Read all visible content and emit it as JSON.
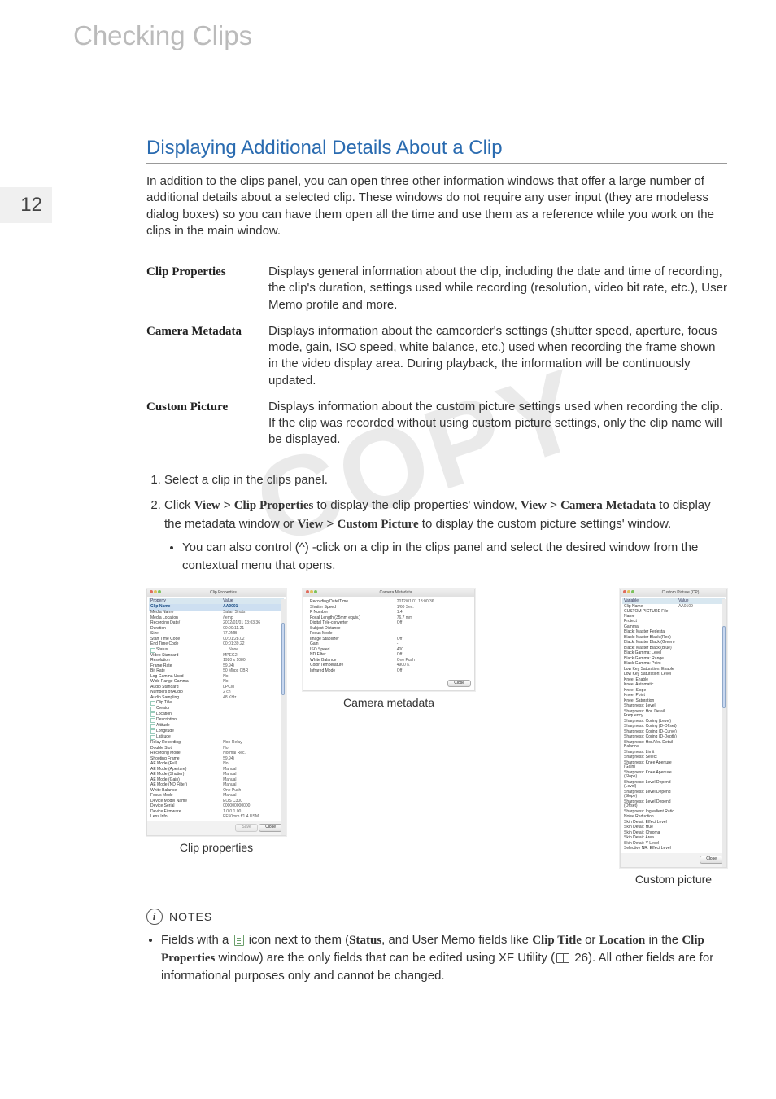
{
  "running_title": "Checking Clips",
  "page_number": "12",
  "section_heading": "Displaying Additional Details About a Clip",
  "intro": "In addition to the clips panel, you can open three other information windows that offer a large number of additional details about a selected clip. These windows do not require any user input (they are modeless dialog boxes) so you can have them open all the time and use them as a reference while you work on the clips in the main window.",
  "info_rows": [
    {
      "label": "Clip Properties",
      "desc": "Displays general information about the clip, including the date and time of recording, the clip's duration, settings used while recording (resolution, video bit rate, etc.), User Memo profile and more."
    },
    {
      "label": "Camera Metadata",
      "desc": "Displays information about the camcorder's settings (shutter speed, aperture, focus mode, gain, ISO speed, white balance, etc.) used when recording the frame shown in the video display area. During playback, the information will be continuously updated."
    },
    {
      "label": "Custom Picture",
      "desc": "Displays information about the custom picture settings used when recording the clip. If the clip was recorded without using custom picture settings, only the clip name will be displayed."
    }
  ],
  "steps": {
    "s1": "Select a clip in the clips panel.",
    "s2_a": "Click ",
    "s2_b1": "View",
    "s2_b2": "Clip Properties",
    "s2_c": " to display the clip properties' window, ",
    "s2_d1": "View",
    "s2_d2": "Camera Metadata",
    "s2_e": " to display the metadata window or ",
    "s2_f1": "View",
    "s2_f2": "Custom Picture",
    "s2_g": " to display the custom picture settings' window.",
    "s2_sub": "You can also control (^) -click on a clip in the clips panel and select the desired window from the contextual menu that opens."
  },
  "watermark": "COPY",
  "clip_props": {
    "title": "Clip Properties",
    "header_k": "Property",
    "header_v": "Value",
    "rows": [
      {
        "k": "Clip Name",
        "v": "AA0001",
        "hl": 1
      },
      {
        "k": "Media Name",
        "v": "Safari Shots"
      },
      {
        "k": "Media Location",
        "v": "/temp"
      },
      {
        "k": "Recording Date/",
        "v": "2012/01/01 13:03:36"
      },
      {
        "k": "Duration",
        "v": "00:00:11.21"
      },
      {
        "k": "Size",
        "v": "77.0MB"
      },
      {
        "k": "Start Time Code",
        "v": "00:01:28.02"
      },
      {
        "k": "End Time Code",
        "v": "00:01:39.22"
      },
      {
        "k": "Status",
        "v": "None",
        "edit": 1
      },
      {
        "k": "Video Standard",
        "v": "MPEG2"
      },
      {
        "k": "Resolution",
        "v": "1920 x 1080"
      },
      {
        "k": "Frame Rate",
        "v": "59.94i"
      },
      {
        "k": "Bit Rate",
        "v": "50 Mbps CBR"
      },
      {
        "k": "Log Gamma Used",
        "v": "No"
      },
      {
        "k": "Wide Range Gamma",
        "v": "No"
      },
      {
        "k": "Audio Standard",
        "v": "LPCM"
      },
      {
        "k": "Numbers of Audio",
        "v": "2 ch"
      },
      {
        "k": "Audio Sampling",
        "v": "48 KHz"
      },
      {
        "k": "Clip Title",
        "v": "",
        "edit": 1
      },
      {
        "k": "Creator",
        "v": "",
        "edit": 1
      },
      {
        "k": "Location",
        "v": "",
        "edit": 1
      },
      {
        "k": "Description",
        "v": "",
        "edit": 1
      },
      {
        "k": "Altitude",
        "v": "",
        "edit": 1
      },
      {
        "k": "Longitude",
        "v": "",
        "edit": 1
      },
      {
        "k": "Latitude",
        "v": "",
        "edit": 1
      },
      {
        "k": "Relay Recording",
        "v": "Non-Relay"
      },
      {
        "k": "Double Slot",
        "v": "No"
      },
      {
        "k": "Recording Mode",
        "v": "Normal Rec."
      },
      {
        "k": "Shooting Frame",
        "v": "59.94i"
      },
      {
        "k": "AE Mode (Full)",
        "v": "No"
      },
      {
        "k": "AE Mode (Aperture)",
        "v": "Manual"
      },
      {
        "k": "AE Mode (Shutter)",
        "v": "Manual"
      },
      {
        "k": "AE Mode (Gain)",
        "v": "Manual"
      },
      {
        "k": "AE Mode (ND Filter)",
        "v": "Manual"
      },
      {
        "k": "White Balance",
        "v": "One Push"
      },
      {
        "k": "Focus Mode",
        "v": "Manual"
      },
      {
        "k": "Device Model Name",
        "v": "EOS C300"
      },
      {
        "k": "Device Serial",
        "v": "000000000000"
      },
      {
        "k": "Device Firmware",
        "v": "1.0.0.1.00"
      },
      {
        "k": "Lens Info.",
        "v": "EF50mm f/1.4 USM"
      }
    ],
    "save": "Save",
    "close": "Close",
    "caption": "Clip properties"
  },
  "camera_meta": {
    "title": "Camera Metadata",
    "rows": [
      {
        "k": "Recording Date/Time",
        "v": "2012/01/01 13:00:36"
      },
      {
        "k": "Shutter Speed",
        "v": "1/60 Sec."
      },
      {
        "k": "F Number",
        "v": "1.4"
      },
      {
        "k": "Focal Length (35mm equiv.)",
        "v": "76.7 mm"
      },
      {
        "k": "Digital Tele-converter",
        "v": "Off"
      },
      {
        "k": "Subject Distance",
        "v": "-"
      },
      {
        "k": "Focus Mode",
        "v": "-"
      },
      {
        "k": "Image Stabilizer",
        "v": "Off"
      },
      {
        "k": "Gain",
        "v": "-"
      },
      {
        "k": "ISO Speed",
        "v": "400"
      },
      {
        "k": "ND Filter",
        "v": "Off"
      },
      {
        "k": "White Balance",
        "v": "One Push"
      },
      {
        "k": "Color Temperature",
        "v": "4900 K"
      },
      {
        "k": "Infrared Mode",
        "v": "Off"
      }
    ],
    "close": "Close",
    "caption": "Camera metadata"
  },
  "custom_pic": {
    "title": "Custom Picture (CP)",
    "rows": [
      {
        "k": "Variable",
        "v": "Value",
        "hdr": 1
      },
      {
        "k": "Clip Name",
        "v": "AA0109"
      },
      {
        "k": "CUSTOM PICTURE File Name",
        "v": ""
      },
      {
        "k": "Protect",
        "v": ""
      },
      {
        "k": "Gamma",
        "v": ""
      },
      {
        "k": "Black: Master Pedestal",
        "v": ""
      },
      {
        "k": "Black: Master Black (Red)",
        "v": ""
      },
      {
        "k": "Black: Master Black (Green)",
        "v": ""
      },
      {
        "k": "Black: Master Black (Blue)",
        "v": ""
      },
      {
        "k": "Black Gamma: Level",
        "v": ""
      },
      {
        "k": "Black Gamma: Range",
        "v": ""
      },
      {
        "k": "Black Gamma: Point",
        "v": ""
      },
      {
        "k": "Low Key Saturation: Enable",
        "v": ""
      },
      {
        "k": "Low Key Saturation: Level",
        "v": ""
      },
      {
        "k": "Knee: Enable",
        "v": ""
      },
      {
        "k": "Knee: Automatic",
        "v": ""
      },
      {
        "k": "Knee: Slope",
        "v": ""
      },
      {
        "k": "Knee: Point",
        "v": ""
      },
      {
        "k": "Knee: Saturation",
        "v": ""
      },
      {
        "k": "Sharpness: Level",
        "v": ""
      },
      {
        "k": "Sharpness: Hor. Detail Frequency",
        "v": ""
      },
      {
        "k": "Sharpness: Coring (Level)",
        "v": ""
      },
      {
        "k": "Sharpness: Coring (D-Offset)",
        "v": ""
      },
      {
        "k": "Sharpness: Coring (D-Curve)",
        "v": ""
      },
      {
        "k": "Sharpness: Coring (D-Depth)",
        "v": ""
      },
      {
        "k": "Sharpness: Hor./Ver. Detail Balance",
        "v": ""
      },
      {
        "k": "Sharpness: Limit",
        "v": ""
      },
      {
        "k": "Sharpness: Select",
        "v": ""
      },
      {
        "k": "Sharpness: Knee Aperture (Gain)",
        "v": ""
      },
      {
        "k": "Sharpness: Knee Aperture (Slope)",
        "v": ""
      },
      {
        "k": "Sharpness: Level Depend (Level)",
        "v": ""
      },
      {
        "k": "Sharpness: Level Depend (Slope)",
        "v": ""
      },
      {
        "k": "Sharpness: Level Depend (Offset)",
        "v": ""
      },
      {
        "k": "Sharpness: Ingredient Ratio",
        "v": ""
      },
      {
        "k": "Noise Reduction",
        "v": ""
      },
      {
        "k": "Skin Detail: Effect Level",
        "v": ""
      },
      {
        "k": "Skin Detail: Hue",
        "v": ""
      },
      {
        "k": "Skin Detail: Chroma",
        "v": ""
      },
      {
        "k": "Skin Detail: Area",
        "v": ""
      },
      {
        "k": "Skin Detail: Y Level",
        "v": ""
      },
      {
        "k": "Selective NR: Effect Level",
        "v": ""
      }
    ],
    "close": "Close",
    "caption": "Custom picture"
  },
  "notes": {
    "title": "NOTES",
    "text_a": "Fields with a ",
    "text_b": " icon next to them (",
    "status": "Status",
    "text_c": ", and User Memo fields like ",
    "f1": "Clip Title",
    "or": " or ",
    "f2": "Location",
    "text_d": " in the ",
    "f3": "Clip Properties",
    "text_e": " window) are the only fields that can be edited using XF Utility (",
    "ref": " 26",
    "text_f": "). All other fields are for informational purposes only and cannot be changed."
  }
}
